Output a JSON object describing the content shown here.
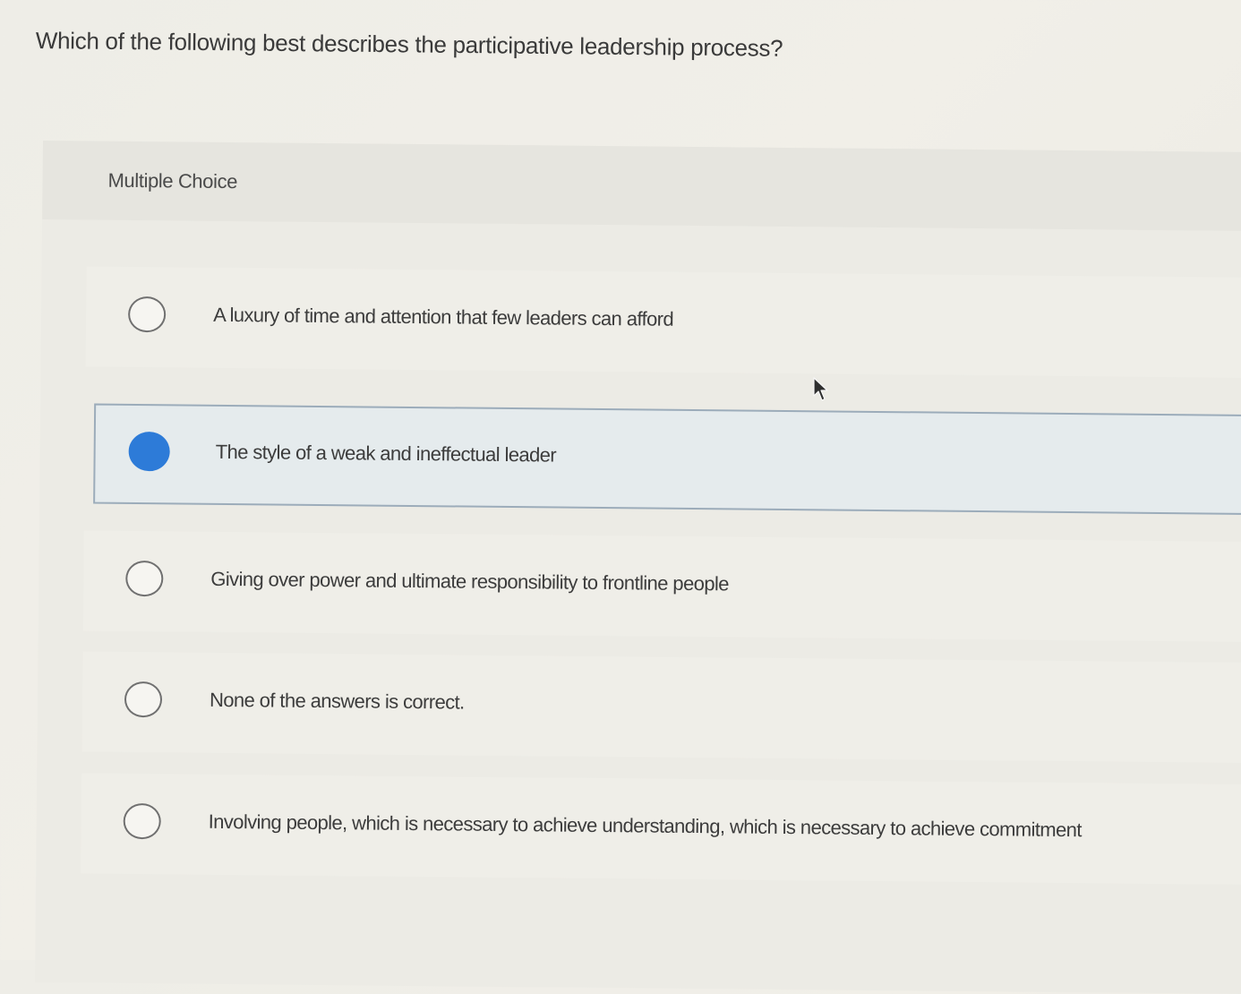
{
  "question": "Which of the following best describes the participative leadership process?",
  "question_type": "Multiple Choice",
  "choices": [
    {
      "label": "A luxury of time and attention that few leaders can afford",
      "selected": false
    },
    {
      "label": "The style of a weak and ineffectual leader",
      "selected": true
    },
    {
      "label": "Giving over power and ultimate responsibility to frontline people",
      "selected": false
    },
    {
      "label": "None of the answers is correct.",
      "selected": false
    },
    {
      "label": "Involving people, which is necessary to achieve understanding, which is necessary to achieve commitment",
      "selected": false
    }
  ],
  "colors": {
    "selected_radio": "#2d7bd8",
    "selected_background": "#e5ebed",
    "selected_border": "#9cacba",
    "page_background": "#eeede7"
  },
  "icons": {
    "cursor": "mouse-pointer-icon",
    "radio_empty": "radio-unchecked-icon",
    "radio_filled": "radio-checked-icon"
  }
}
